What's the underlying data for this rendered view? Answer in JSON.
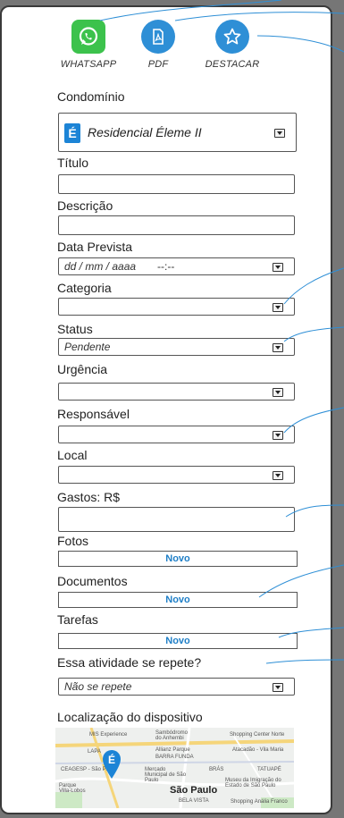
{
  "actions": {
    "whatsapp": "WHATSAPP",
    "pdf": "PDF",
    "destacar": "DESTACAR"
  },
  "fields": {
    "condominio_label": "Condomínio",
    "condominio_value": "Residencial Éleme II",
    "titulo_label": "Título",
    "descricao_label": "Descrição",
    "data_label": "Data Prevista",
    "data_placeholder": "dd / mm / aaaa",
    "time_placeholder": "--:--",
    "categoria_label": "Categoria",
    "status_label": "Status",
    "status_value": "Pendente",
    "urgencia_label": "Urgência",
    "responsavel_label": "Responsável",
    "local_label": "Local",
    "gastos_label": "Gastos: R$",
    "fotos_label": "Fotos",
    "documentos_label": "Documentos",
    "tarefas_label": "Tarefas",
    "novo": "Novo",
    "repete_label": "Essa atividade se repete?",
    "repete_value": "Não se repete",
    "localizacao_label": "Localização do dispositivo"
  },
  "map": {
    "labels": [
      "MIS Experience",
      "Sambódromo do Anhembi",
      "Shopping Center Norte",
      "LAPA",
      "Allianz Parque",
      "BARRA FUNDA",
      "Atacadão - Vila Maria",
      "CEAGESP - São Paulo",
      "Mercado Municipal de São Paulo",
      "BRÁS",
      "TATUAPÉ",
      "Parque Villa-Lobos",
      "São Paulo",
      "Museu da Imigração do Estado de São Paulo",
      "BELA VISTA",
      "Shopping Anália Franco"
    ]
  },
  "colors": {
    "accent": "#2e8fd6",
    "whatsapp": "#3cc24c",
    "novo_text": "#1f7fc7"
  }
}
